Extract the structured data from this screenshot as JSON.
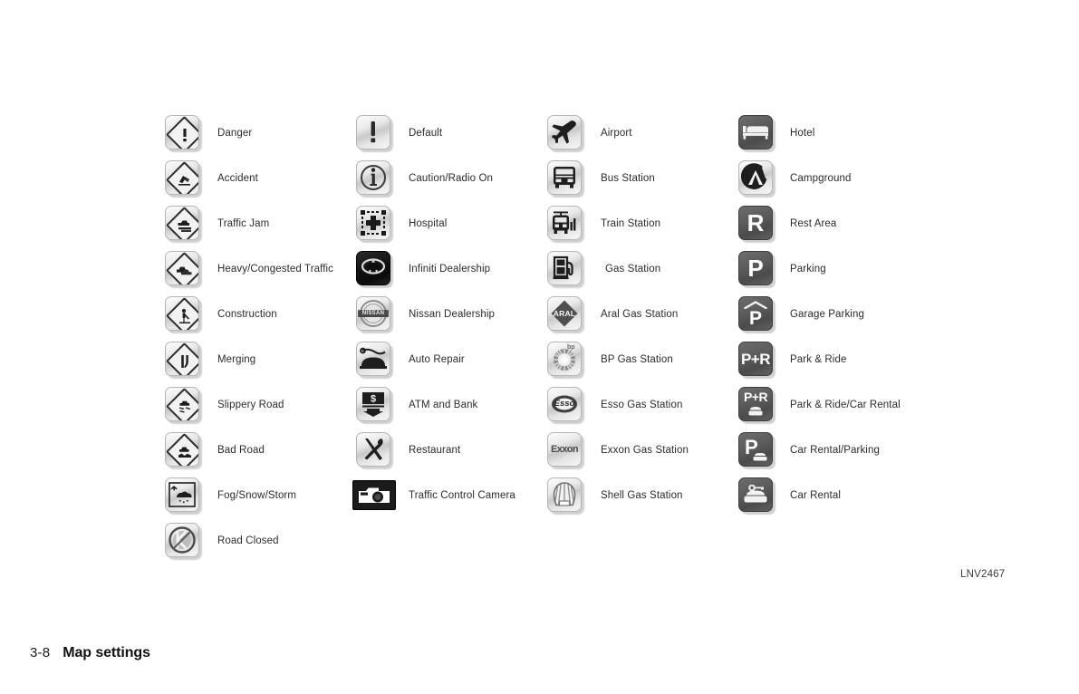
{
  "document": {
    "page_number": "3-8",
    "section_title": "Map settings",
    "figure_code": "LNV2467"
  },
  "legend": {
    "columns": [
      {
        "name": "traffic-warning-icons",
        "items": [
          {
            "icon": "danger-diamond-icon",
            "label": "Danger"
          },
          {
            "icon": "accident-diamond-icon",
            "label": "Accident"
          },
          {
            "icon": "traffic-jam-diamond-icon",
            "label": "Traffic Jam"
          },
          {
            "icon": "heavy-congested-traffic-diamond-icon",
            "label": "Heavy/Congested Traffic"
          },
          {
            "icon": "construction-diamond-icon",
            "label": "Construction"
          },
          {
            "icon": "merging-diamond-icon",
            "label": "Merging"
          },
          {
            "icon": "slippery-road-diamond-icon",
            "label": "Slippery Road"
          },
          {
            "icon": "bad-road-diamond-icon",
            "label": "Bad Road"
          },
          {
            "icon": "fog-snow-storm-icon",
            "label": "Fog/Snow/Storm"
          },
          {
            "icon": "road-closed-icon",
            "label": "Road Closed"
          }
        ]
      },
      {
        "name": "general-poi-icons",
        "items": [
          {
            "icon": "default-exclamation-icon",
            "label": "Default"
          },
          {
            "icon": "caution-radio-on-info-icon",
            "label": "Caution/Radio On"
          },
          {
            "icon": "hospital-cross-icon",
            "label": "Hospital"
          },
          {
            "icon": "infiniti-dealership-icon",
            "label": "Infiniti Dealership"
          },
          {
            "icon": "nissan-dealership-icon",
            "label": "Nissan Dealership"
          },
          {
            "icon": "auto-repair-wrench-car-icon",
            "label": "Auto Repair"
          },
          {
            "icon": "atm-and-bank-icon",
            "label": "ATM and Bank"
          },
          {
            "icon": "restaurant-fork-knife-icon",
            "label": "Restaurant"
          },
          {
            "icon": "traffic-control-camera-icon",
            "label": "Traffic Control Camera"
          }
        ]
      },
      {
        "name": "transport-fuel-icons",
        "items": [
          {
            "icon": "airport-plane-icon",
            "label": "Airport"
          },
          {
            "icon": "bus-station-icon",
            "label": "Bus Station"
          },
          {
            "icon": "train-station-icon",
            "label": "Train Station"
          },
          {
            "icon": "gas-station-pump-icon",
            "label": "Gas Station"
          },
          {
            "icon": "aral-gas-station-icon",
            "label": "Aral Gas Station"
          },
          {
            "icon": "bp-gas-station-icon",
            "label": "BP Gas Station"
          },
          {
            "icon": "esso-gas-station-icon",
            "label": "Esso Gas Station"
          },
          {
            "icon": "exxon-gas-station-icon",
            "label": "Exxon Gas Station"
          },
          {
            "icon": "shell-gas-station-icon",
            "label": "Shell Gas Station"
          }
        ]
      },
      {
        "name": "lodging-parking-icons",
        "items": [
          {
            "icon": "hotel-bed-icon",
            "label": "Hotel"
          },
          {
            "icon": "campground-tent-icon",
            "label": "Campground"
          },
          {
            "icon": "rest-area-r-icon",
            "label": "Rest Area"
          },
          {
            "icon": "parking-p-icon",
            "label": "Parking"
          },
          {
            "icon": "garage-parking-icon",
            "label": "Garage Parking"
          },
          {
            "icon": "park-and-ride-icon",
            "label": "Park & Ride"
          },
          {
            "icon": "park-and-ride-car-rental-icon",
            "label": "Park & Ride/Car Rental"
          },
          {
            "icon": "car-rental-parking-icon",
            "label": "Car Rental/Parking"
          },
          {
            "icon": "car-rental-icon",
            "label": "Car Rental"
          }
        ]
      }
    ]
  },
  "brand_text": {
    "aral": "ARAL",
    "bp": "bp",
    "nissan": "NISSAN",
    "esso": "Esso",
    "exxon": "Exxon",
    "rest_area": "R",
    "parking": "P",
    "garage_parking": "P",
    "park_and_ride": "P+R",
    "park_and_ride_car_rental": "P+R",
    "car_rental_parking": "P"
  },
  "colors": {
    "page_background": "#ffffff",
    "text": "#2b2b2b",
    "tile_light": "#d9d9d9",
    "tile_dark": "#5a5a5a",
    "tile_black": "#141414"
  }
}
